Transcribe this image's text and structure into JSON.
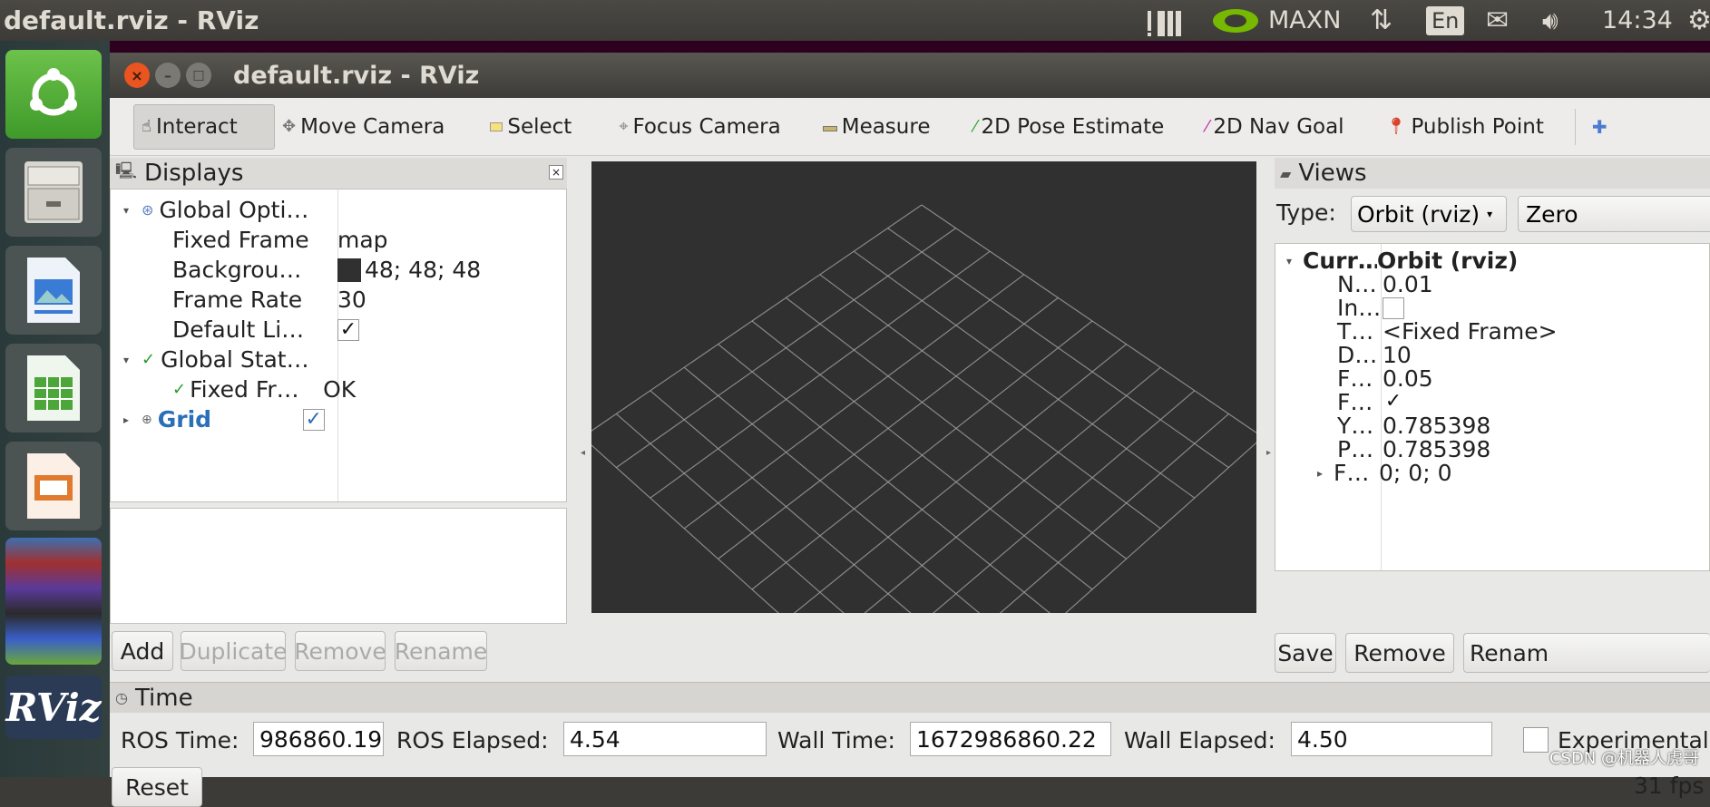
{
  "topbar": {
    "title": "default.rviz - RViz",
    "power_mode": "MAXN",
    "lang": "En",
    "clock": "14:34"
  },
  "window": {
    "title": "default.rviz - RViz"
  },
  "toolbar": {
    "tools": [
      "Interact",
      "Move Camera",
      "Select",
      "Focus Camera",
      "Measure",
      "2D Pose Estimate",
      "2D Nav Goal",
      "Publish Point"
    ]
  },
  "displays": {
    "header": "Displays",
    "rows": [
      {
        "name": "Global Opti…",
        "value": ""
      },
      {
        "name": "Fixed Frame",
        "value": "map"
      },
      {
        "name": "Backgrou…",
        "value": "48; 48; 48"
      },
      {
        "name": "Frame Rate",
        "value": "30"
      },
      {
        "name": "Default Li…",
        "value": "✓"
      },
      {
        "name": "Global Stat…",
        "value": ""
      },
      {
        "name": "Fixed Fr…",
        "value": "OK"
      },
      {
        "name": "Grid",
        "value": "✓"
      }
    ],
    "buttons": [
      "Add",
      "Duplicate",
      "Remove",
      "Rename"
    ]
  },
  "views": {
    "header": "Views",
    "type_label": "Type:",
    "type_value": "Orbit (rviz)",
    "zero_label": "Zero",
    "rows": [
      {
        "name": "Curr…",
        "value": "Orbit (rviz)"
      },
      {
        "name": "N…",
        "value": "0.01"
      },
      {
        "name": "In…",
        "value": ""
      },
      {
        "name": "T…",
        "value": "<Fixed Frame>"
      },
      {
        "name": "D…",
        "value": "10"
      },
      {
        "name": "F…",
        "value": "0.05"
      },
      {
        "name": "F…",
        "value": "✓"
      },
      {
        "name": "Y…",
        "value": "0.785398"
      },
      {
        "name": "P…",
        "value": "0.785398"
      },
      {
        "name": "F…",
        "value": "0; 0; 0"
      }
    ],
    "buttons": [
      "Save",
      "Remove",
      "Renam"
    ]
  },
  "time": {
    "header": "Time",
    "ros_time_label": "ROS Time:",
    "ros_time": "986860.19",
    "ros_elapsed_label": "ROS Elapsed:",
    "ros_elapsed": "4.54",
    "wall_time_label": "Wall Time:",
    "wall_time": "1672986860.22",
    "wall_elapsed_label": "Wall Elapsed:",
    "wall_elapsed": "4.50",
    "experimental_label": "Experimental",
    "reset_label": "Reset",
    "fps": "31 fps"
  },
  "watermark": "CSDN @机器人虎哥",
  "colors": {
    "viewport_bg": "#303030",
    "grid": "#a0a0a0",
    "link_blue": "#2a6fb8",
    "close_red": "#e95420"
  },
  "launcher_icons": [
    "ubuntu-dash-icon",
    "files-icon",
    "writer-icon",
    "calc-icon",
    "impress-icon",
    "stacked-apps-icon",
    "rviz-icon"
  ]
}
